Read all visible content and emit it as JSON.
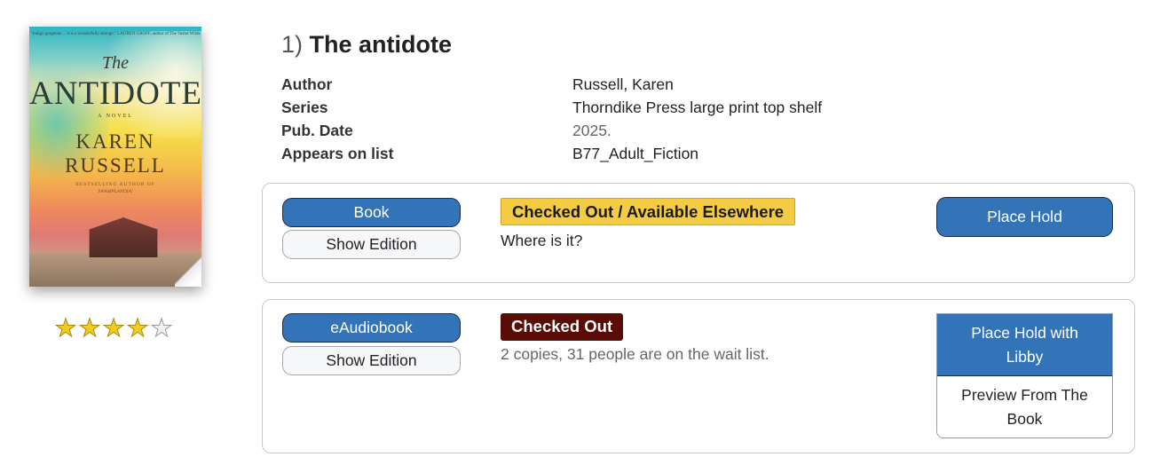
{
  "cover": {
    "blurb": "\"Indigo gorgeous ... it is a wonderfully strange.\" LAUREN GROFF, author of The Vaster Wilds",
    "the": "The",
    "title": "ANTIDOTE",
    "novel": "A NOVEL",
    "author_first": "KAREN",
    "author_last": "RUSSELL",
    "byline1": "BESTSELLING AUTHOR OF",
    "byline2": "SWAMPLANDIA!"
  },
  "rating": {
    "value": 4,
    "max": 5
  },
  "result": {
    "number": "1)",
    "title": "The antidote"
  },
  "meta": [
    {
      "label": "Author",
      "value": "Russell, Karen"
    },
    {
      "label": "Series",
      "value": "Thorndike Press large print top shelf"
    },
    {
      "label": "Pub. Date",
      "value": "2025."
    },
    {
      "label": "Appears on list",
      "value": "B77_Adult_Fiction"
    }
  ],
  "formats": [
    {
      "format_label": "Book",
      "edition_label": "Show Edition",
      "status": "Checked Out / Available Elsewhere",
      "status_color": "#f4cc44",
      "detail": "Where is it?",
      "action": "Place Hold"
    },
    {
      "format_label": "eAudiobook",
      "edition_label": "Show Edition",
      "status": "Checked Out",
      "status_color": "#5a0c07",
      "detail": "2 copies, 31 people are on the wait list.",
      "action_line1": "Place Hold with",
      "action_line2": "Libby",
      "secondary_line1": "Preview From The",
      "secondary_line2": "Book"
    }
  ]
}
